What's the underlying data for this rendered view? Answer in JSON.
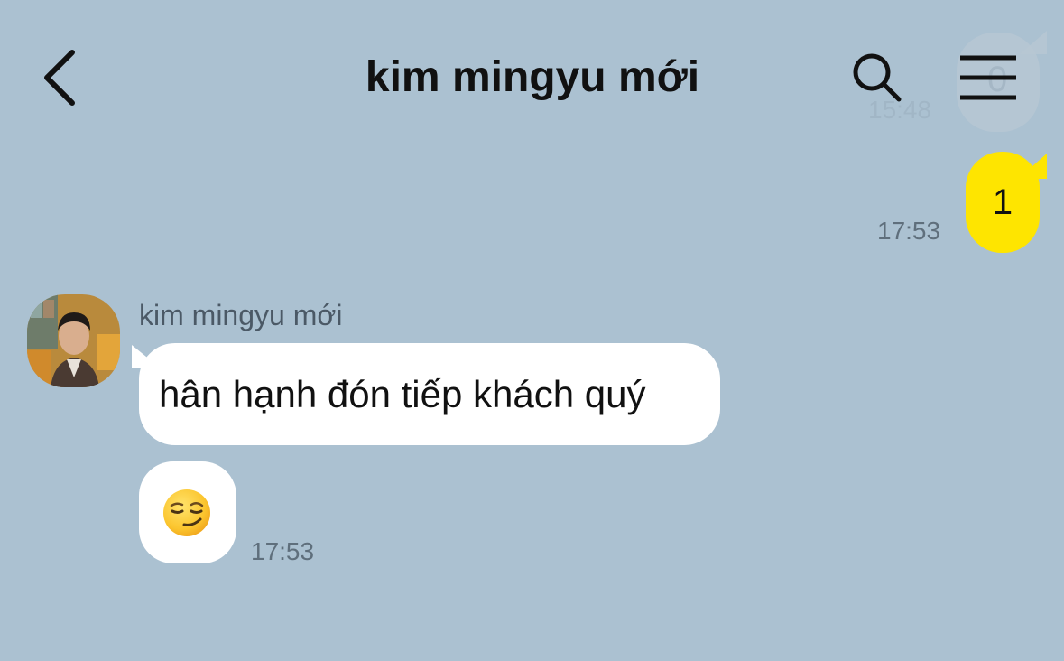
{
  "header": {
    "title": "kim mingyu mới",
    "back_icon": "chevron-left-icon",
    "search_icon": "search-icon",
    "menu_icon": "hamburger-menu-icon"
  },
  "previous_message": {
    "text": "0",
    "time": "15:48"
  },
  "outgoing_message": {
    "text": "1",
    "time": "17:53",
    "bubble_color": "#fee500"
  },
  "incoming": {
    "sender_name": "kim mingyu mới",
    "avatar_icon": "profile-avatar",
    "messages": [
      {
        "text": "hân hạnh đón tiếp khách quý"
      },
      {
        "emoji": "smirking-face-emoji"
      }
    ],
    "time": "17:53",
    "bubble_color": "#ffffff"
  },
  "colors": {
    "background": "#abc1d1",
    "timestamp": "#5f6f7c",
    "sender_name": "#4b5966"
  }
}
